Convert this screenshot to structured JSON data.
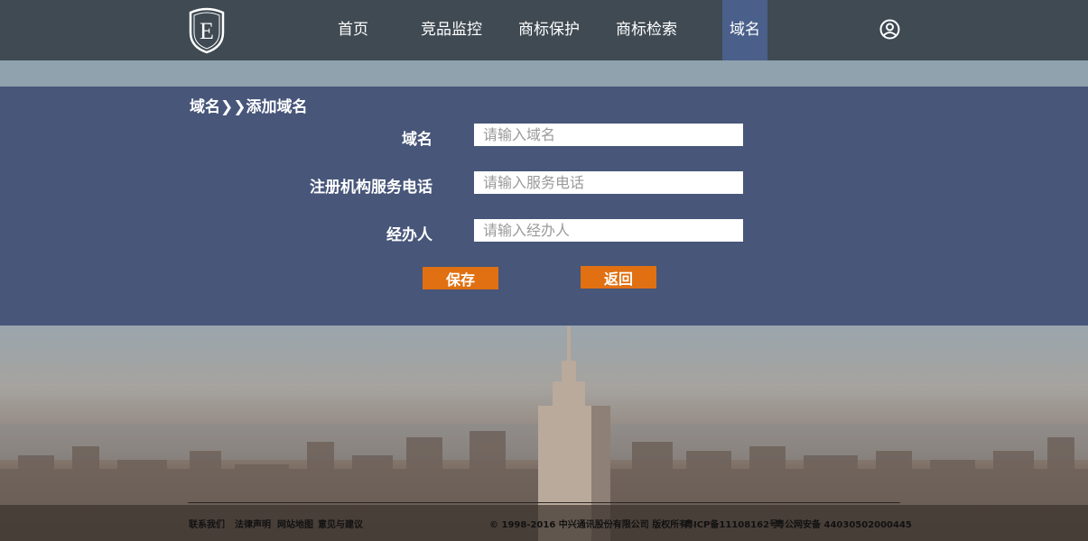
{
  "nav": {
    "items": [
      {
        "label": "首页"
      },
      {
        "label": "竞品监控"
      },
      {
        "label": "商标保护"
      },
      {
        "label": "商标检索"
      },
      {
        "label": "域名"
      }
    ],
    "logo_letter": "E"
  },
  "breadcrumb": "域名❯❯添加域名",
  "form": {
    "fields": [
      {
        "label": "域名",
        "placeholder": "请输入域名",
        "value": ""
      },
      {
        "label": "注册机构服务电话",
        "placeholder": "请输入服务电话",
        "value": ""
      },
      {
        "label": "经办人",
        "placeholder": "请输入经办人",
        "value": ""
      }
    ],
    "save_label": "保存",
    "back_label": "返回"
  },
  "footer": {
    "links": [
      "联系我们",
      "法律声明",
      "网站地图",
      "意见与建议"
    ],
    "copyright": "© 1998-2016 中兴通讯股份有限公司 版权所有",
    "icp": "粤ICP备11108162号",
    "police": "粤公网安备 44030502000445"
  },
  "colors": {
    "header_bg": "#3f4a52",
    "panel_bg": "#475679",
    "active_nav": "#4a5f8a",
    "button": "#e07012"
  }
}
